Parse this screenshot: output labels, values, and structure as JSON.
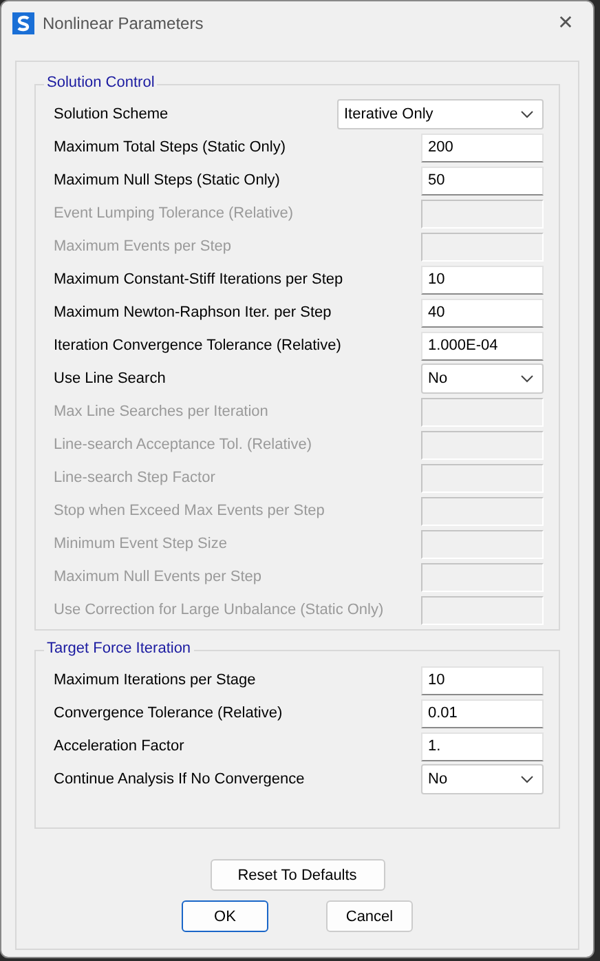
{
  "window": {
    "title": "Nonlinear Parameters",
    "close": "✕"
  },
  "groups": [
    {
      "title": "Solution Control",
      "rows": [
        {
          "label": "Solution Scheme",
          "kind": "wide-select",
          "value": "Iterative Only",
          "disabled": false
        },
        {
          "label": "Maximum Total Steps (Static Only)",
          "kind": "text",
          "value": "200",
          "disabled": false
        },
        {
          "label": "Maximum Null Steps (Static Only)",
          "kind": "text",
          "value": "50",
          "disabled": false
        },
        {
          "label": "Event Lumping Tolerance (Relative)",
          "kind": "text",
          "disabled": true
        },
        {
          "label": "Maximum Events per Step",
          "kind": "text",
          "disabled": true
        },
        {
          "label": "Maximum Constant-Stiff Iterations per Step",
          "kind": "text",
          "value": "10",
          "disabled": false
        },
        {
          "label": "Maximum Newton-Raphson Iter. per Step",
          "kind": "text",
          "value": "40",
          "disabled": false
        },
        {
          "label": "Iteration Convergence Tolerance (Relative)",
          "kind": "text",
          "value": "1.000E-04",
          "disabled": false
        },
        {
          "label": "Use Line Search",
          "kind": "select",
          "value": "No",
          "disabled": false
        },
        {
          "label": "Max Line Searches per Iteration",
          "kind": "text",
          "disabled": true
        },
        {
          "label": "Line-search Acceptance Tol. (Relative)",
          "kind": "text",
          "disabled": true
        },
        {
          "label": "Line-search Step Factor",
          "kind": "text",
          "disabled": true
        },
        {
          "label": "Stop when Exceed Max Events per Step",
          "kind": "text",
          "disabled": true
        },
        {
          "label": "Minimum Event Step Size",
          "kind": "text",
          "disabled": true
        },
        {
          "label": "Maximum Null Events per Step",
          "kind": "text",
          "disabled": true
        },
        {
          "label": "Use Correction for Large Unbalance (Static Only)",
          "kind": "text",
          "disabled": true
        }
      ]
    },
    {
      "title": "Target Force Iteration",
      "rows": [
        {
          "label": "Maximum Iterations per Stage",
          "kind": "text",
          "value": "10",
          "disabled": false
        },
        {
          "label": "Convergence Tolerance (Relative)",
          "kind": "text",
          "value": "0.01",
          "disabled": false
        },
        {
          "label": "Acceleration Factor",
          "kind": "text",
          "value": "1.",
          "disabled": false
        },
        {
          "label": "Continue Analysis If No Convergence",
          "kind": "select",
          "value": "No",
          "disabled": false
        }
      ]
    }
  ],
  "buttons": {
    "reset": "Reset To Defaults",
    "ok": "OK",
    "cancel": "Cancel"
  }
}
